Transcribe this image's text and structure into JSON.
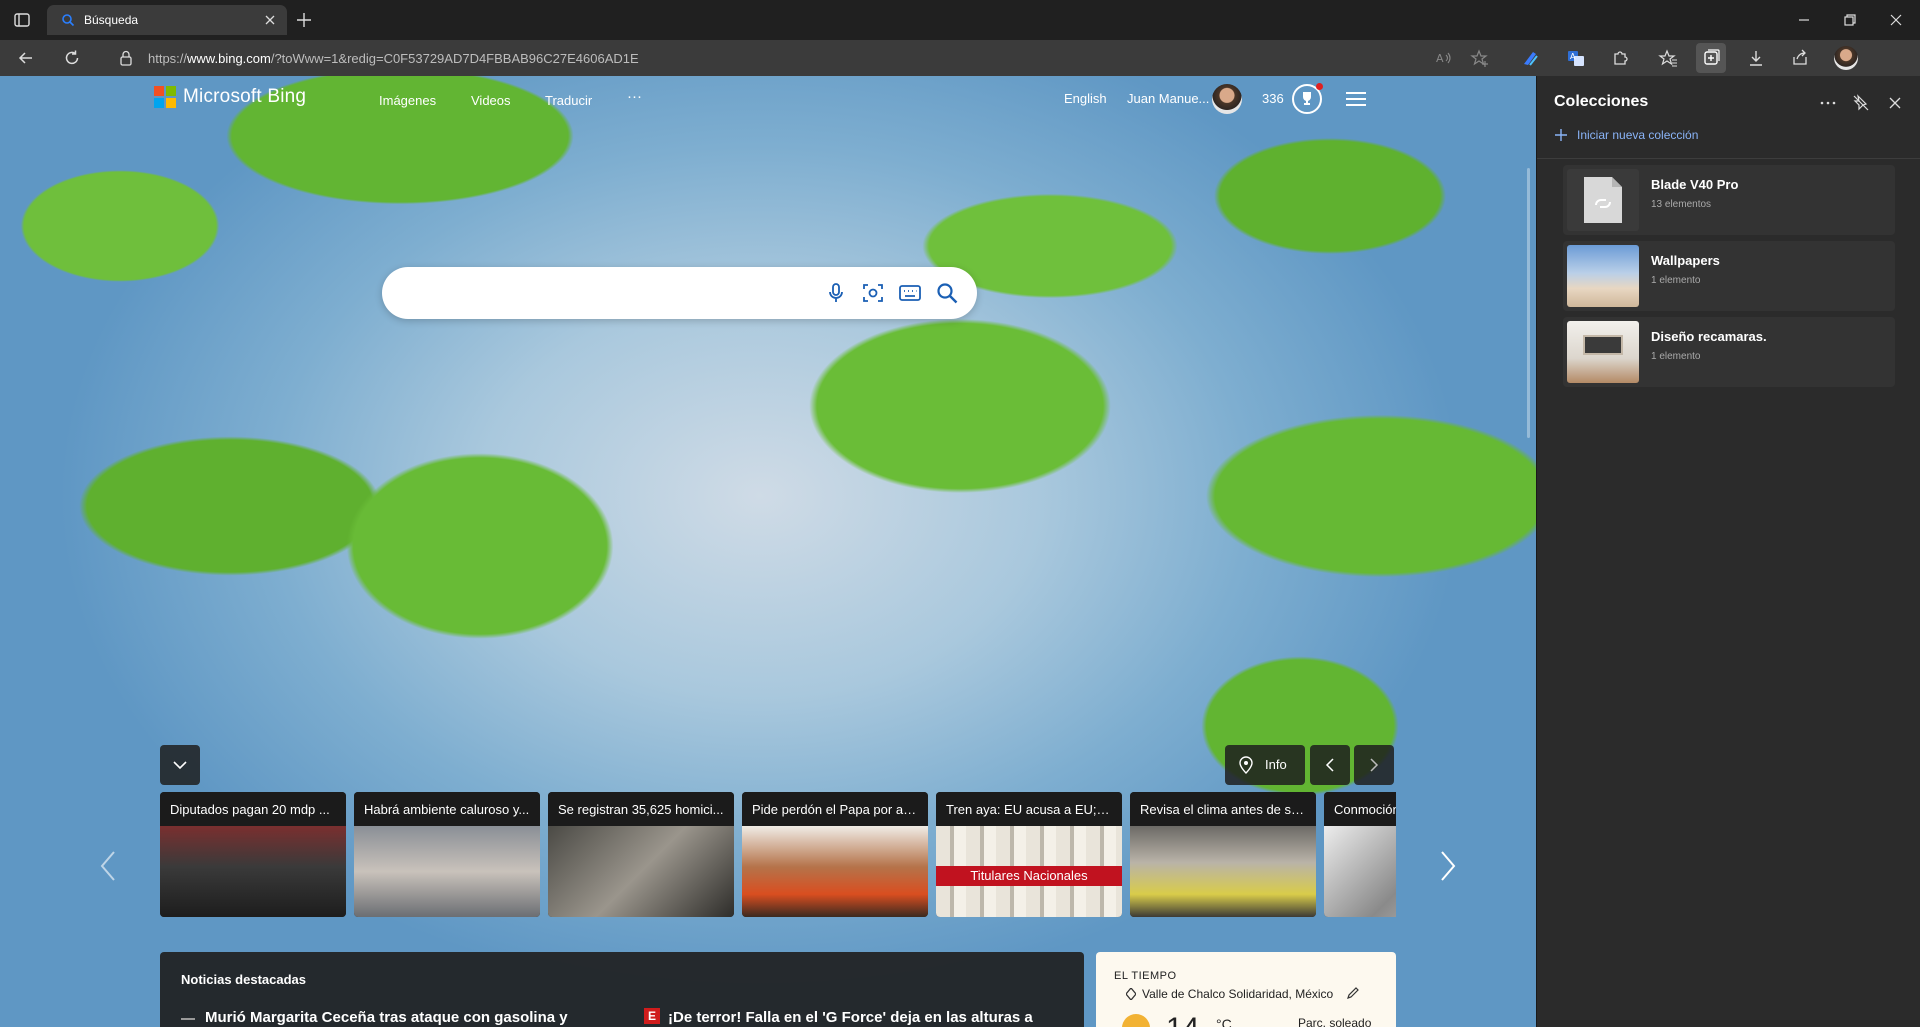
{
  "browser": {
    "tab_title": "Búsqueda",
    "url_prefix": "https://",
    "url_host": "www.bing.com",
    "url_path": "/?toWww=1&redig=C0F53729AD7D4FBBAB96C27E4606AD1E"
  },
  "bing": {
    "logo_text": "Microsoft Bing",
    "nav": [
      "Imágenes",
      "Videos",
      "Traducir",
      "···"
    ],
    "language": "English",
    "user_name": "Juan Manue...",
    "points": "336",
    "search_placeholder": "",
    "info_label": "Info",
    "news_cards": [
      "Diputados pagan 20 mdp ...",
      "Habrá ambiente caluroso y...",
      "Se registran 35,625 homici...",
      "Pide perdón el Papa por ab...",
      "Tren aya: EU acusa a EU; Ve...",
      "Revisa el clima antes de sal...",
      "Conmoción"
    ],
    "card5_overlay": "Titulares Nacionales",
    "top_news": {
      "heading": "Noticias destacadas",
      "item1": "Murió Margarita Ceceña tras ataque con gasolina y",
      "item2_badge": "E",
      "item2": "¡De terror! Falla en el 'G Force' deja en las alturas a"
    },
    "weather": {
      "label": "EL TIEMPO",
      "location": "Valle de Chalco Solidaridad, México",
      "temp": "14",
      "unit": "°C",
      "condition": "Parc. soleado"
    }
  },
  "collections": {
    "title": "Colecciones",
    "new_collection": "Iniciar nueva colección",
    "items": [
      {
        "name": "Blade V40 Pro",
        "count": "13 elementos"
      },
      {
        "name": "Wallpapers",
        "count": "1 elemento"
      },
      {
        "name": "Diseño recamaras.",
        "count": "1 elemento"
      }
    ]
  },
  "colors": {
    "accent_link": "#8ab4f8",
    "ms_red": "#f25022",
    "ms_green": "#7fba00",
    "ms_blue": "#00a4ef",
    "ms_yellow": "#ffb900"
  }
}
